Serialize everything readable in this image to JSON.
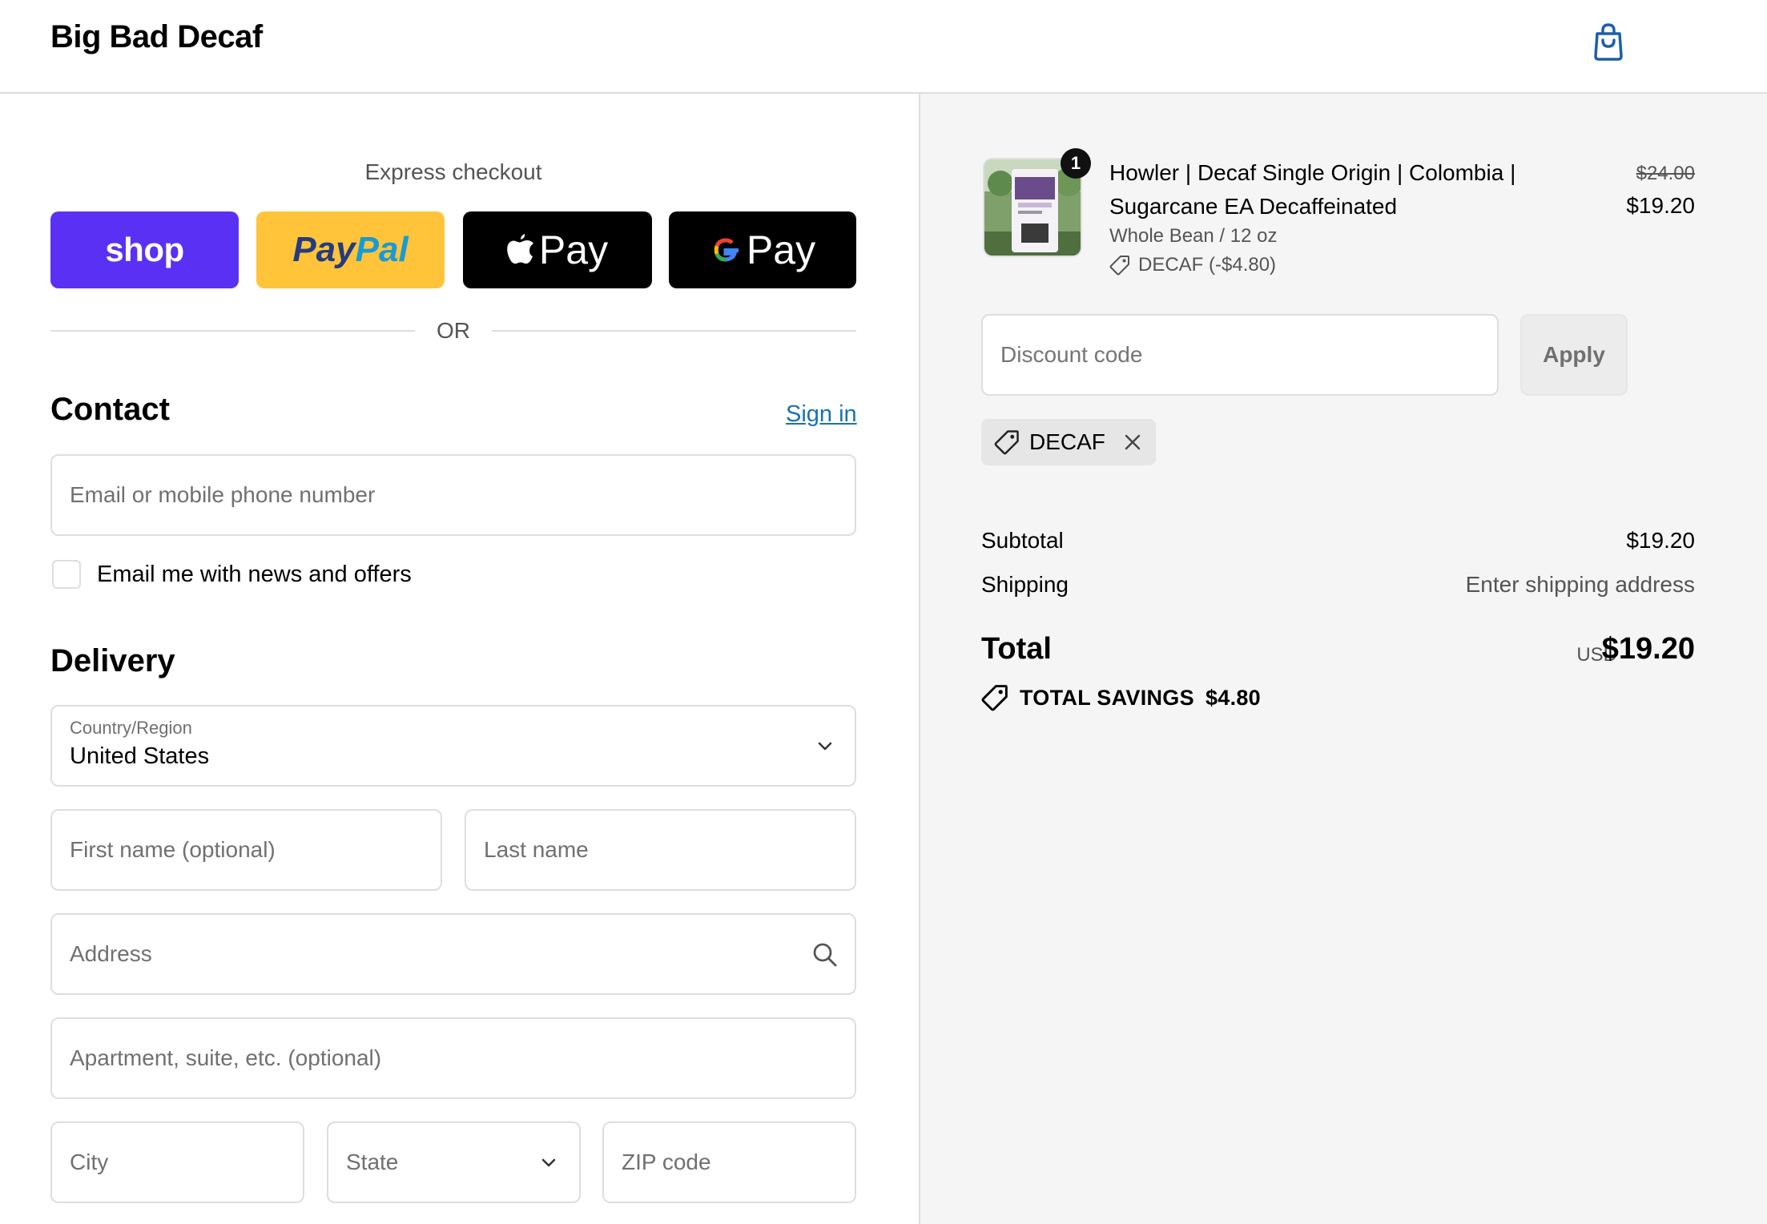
{
  "header": {
    "brand": "Big Bad Decaf",
    "cart_icon": "shopping-bag-icon"
  },
  "express": {
    "title": "Express checkout",
    "shop_label": "shop",
    "paypal_part1": "Pay",
    "paypal_part2": "Pal",
    "apple_label": "Pay",
    "gpay_label": "Pay",
    "or_label": "OR"
  },
  "contact": {
    "title": "Contact",
    "signin_label": "Sign in",
    "email_placeholder": "Email or mobile phone number",
    "newsletter_label": "Email me with news and offers",
    "newsletter_checked": false
  },
  "delivery": {
    "title": "Delivery",
    "country_label": "Country/Region",
    "country_value": "United States",
    "first_name_placeholder": "First name (optional)",
    "last_name_placeholder": "Last name",
    "address_placeholder": "Address",
    "apartment_placeholder": "Apartment, suite, etc. (optional)",
    "city_placeholder": "City",
    "state_placeholder": "State",
    "zip_placeholder": "ZIP code"
  },
  "order": {
    "quantity": "1",
    "product_name": "Howler | Decaf Single Origin | Colombia | Sugarcane EA Decaffeinated",
    "variant": "Whole Bean / 12 oz",
    "discount_line": "DECAF (-$4.80)",
    "price_original": "$24.00",
    "price_final": "$19.20",
    "discount_placeholder": "Discount code",
    "apply_label": "Apply",
    "applied_code": "DECAF",
    "subtotal_label": "Subtotal",
    "subtotal_value": "$19.20",
    "shipping_label": "Shipping",
    "shipping_value": "Enter shipping address",
    "total_label": "Total",
    "currency": "USD",
    "total_value": "$19.20",
    "savings_label": "TOTAL SAVINGS",
    "savings_value": "$4.80"
  },
  "colors": {
    "shop": "#5a31f4",
    "paypal": "#ffc439",
    "link": "#1773b0",
    "cart_icon": "#1e5ea8"
  }
}
